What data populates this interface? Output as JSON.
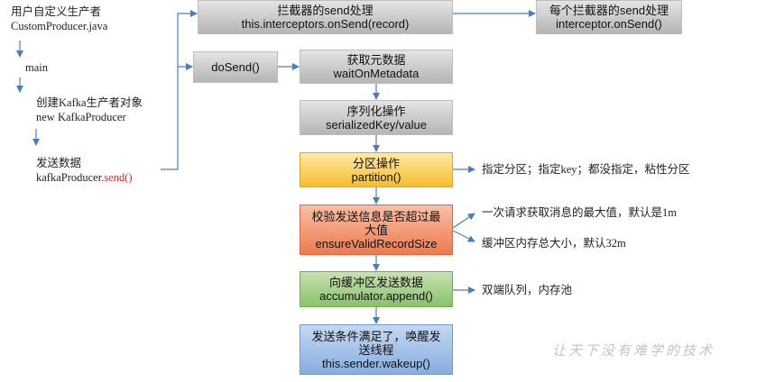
{
  "left": {
    "title_line1": "用户自定义生产者",
    "title_line2": "CustomProducer.java",
    "main": "main",
    "create_line1": "创建Kafka生产者对象",
    "create_line2": "new KafkaProducer",
    "send_line1": "发送数据",
    "send_prefix": "kafkaProducer.",
    "send_method": "send()"
  },
  "boxes": {
    "interceptors_l1": "拦截器的send处理",
    "interceptors_l2": "this.interceptors.onSend(record)",
    "each_l1": "每个拦截器的send处理",
    "each_l2": "interceptor.onSend()",
    "dosend": "doSend()",
    "metadata_l1": "获取元数据",
    "metadata_l2": "waitOnMetadata",
    "serialize_l1": "序列化操作",
    "serialize_l2": "serializedKey/value",
    "partition_l1": "分区操作",
    "partition_l2": "partition()",
    "validate_l1": "校验发送信息是否超过最",
    "validate_l2": "大值",
    "validate_l3": "ensureValidRecordSize",
    "append_l1": "向缓冲区发送数据",
    "append_l2": "accumulator.append()",
    "wakeup_l1": "发送条件满足了，唤醒发",
    "wakeup_l2": "送线程",
    "wakeup_l3": "this.sender.wakeup()"
  },
  "notes": {
    "partition": "指定分区；指定key；都没指定，粘性分区",
    "request_max": "一次请求获取消息的最大值，默认是1m",
    "buffer_size": "缓冲区内存总大小，默认32m",
    "deque": "双端队列，内存池"
  },
  "watermark": "让天下没有难学的技术",
  "colors": {
    "arrow": "#4a7ebb",
    "gray": "#c8c8c8",
    "yellow": "#f9cd55",
    "orange": "#f09568",
    "green": "#a6d188",
    "blue": "#a3c2ea",
    "highlight": "#e02020"
  }
}
